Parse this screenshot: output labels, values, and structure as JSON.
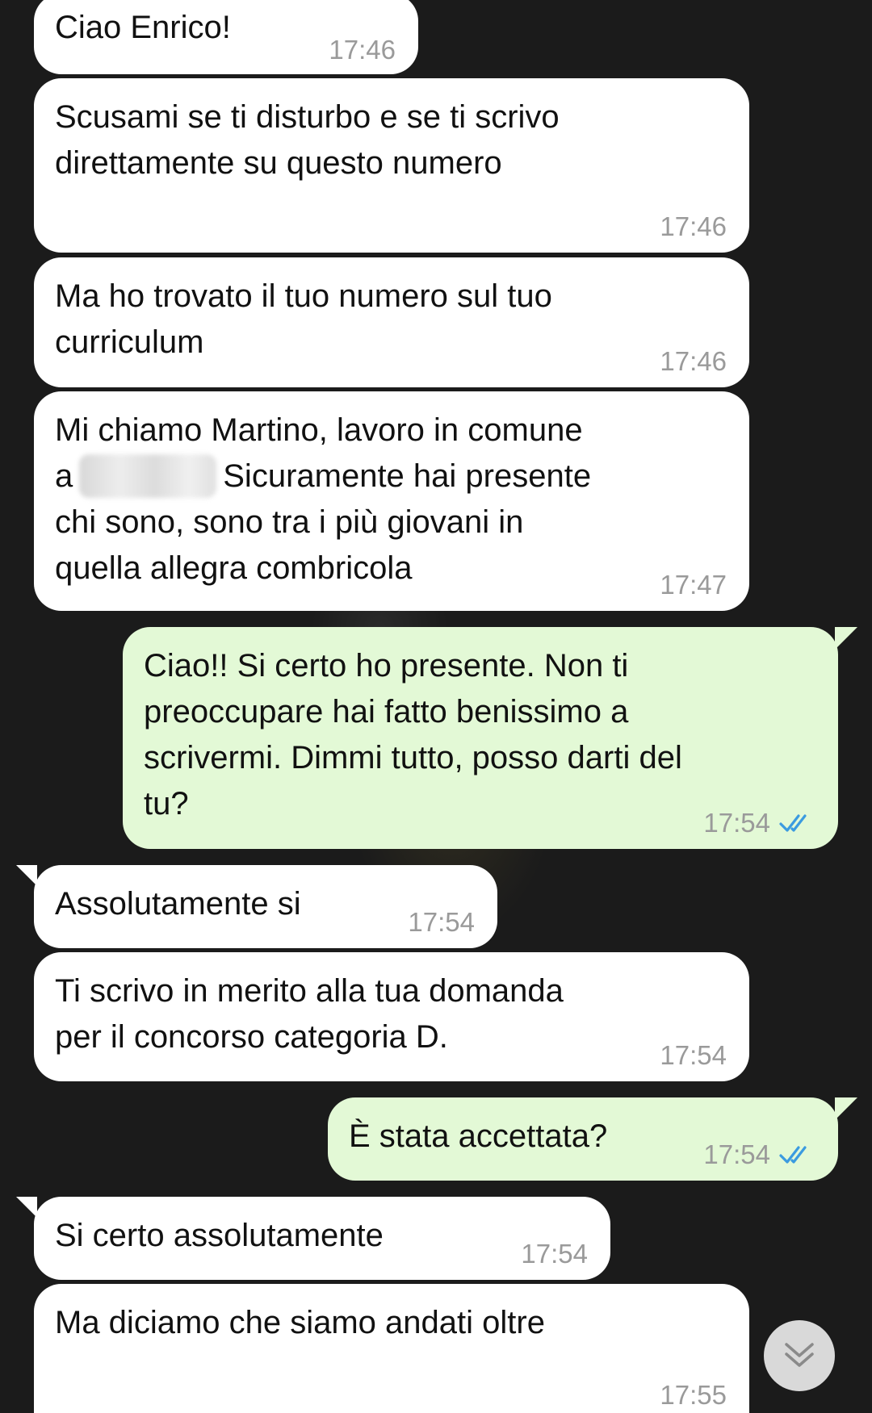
{
  "messages": [
    {
      "id": "m1",
      "direction": "incoming",
      "text": "Ciao Enrico!",
      "time": "17:46"
    },
    {
      "id": "m2",
      "direction": "incoming",
      "text": "Scusami se ti disturbo e se ti scrivo\ndirettamente su questo numero",
      "time": "17:46"
    },
    {
      "id": "m3",
      "direction": "incoming",
      "text": "Ma ho trovato il tuo numero sul tuo\ncurriculum",
      "time": "17:46"
    },
    {
      "id": "m4",
      "direction": "incoming",
      "text_before_redaction": "Mi chiamo Martino, lavoro in comune\na",
      "text_after_redaction": "Sicuramente hai presente\nchi sono, sono tra i più giovani in\nquella allegra combricola",
      "time": "17:47"
    },
    {
      "id": "m5",
      "direction": "outgoing",
      "text": "Ciao!! Si certo ho presente. Non ti\npreoccupare hai fatto benissimo a\nscrivermi. Dimmi tutto, posso darti del\ntu?",
      "time": "17:54",
      "status": "read"
    },
    {
      "id": "m6",
      "direction": "incoming",
      "text": "Assolutamente si",
      "time": "17:54"
    },
    {
      "id": "m7",
      "direction": "incoming",
      "text": "Ti scrivo in merito alla tua domanda\nper il concorso categoria D.",
      "time": "17:54"
    },
    {
      "id": "m8",
      "direction": "outgoing",
      "text": "È stata accettata?",
      "time": "17:54",
      "status": "read"
    },
    {
      "id": "m9",
      "direction": "incoming",
      "text": "Si certo assolutamente",
      "time": "17:54"
    },
    {
      "id": "m10",
      "direction": "incoming",
      "text": "Ma diciamo che siamo andati oltre",
      "time": "17:55"
    }
  ],
  "icons": {
    "read_receipt": "double-check-icon",
    "scroll_down": "chevron-double-down-icon"
  },
  "colors": {
    "incoming_bubble": "#ffffff",
    "outgoing_bubble": "#e3f9d6",
    "read_tick": "#3b9be0",
    "timestamp": "#9a9a9a",
    "background": "#1b1b1b"
  }
}
